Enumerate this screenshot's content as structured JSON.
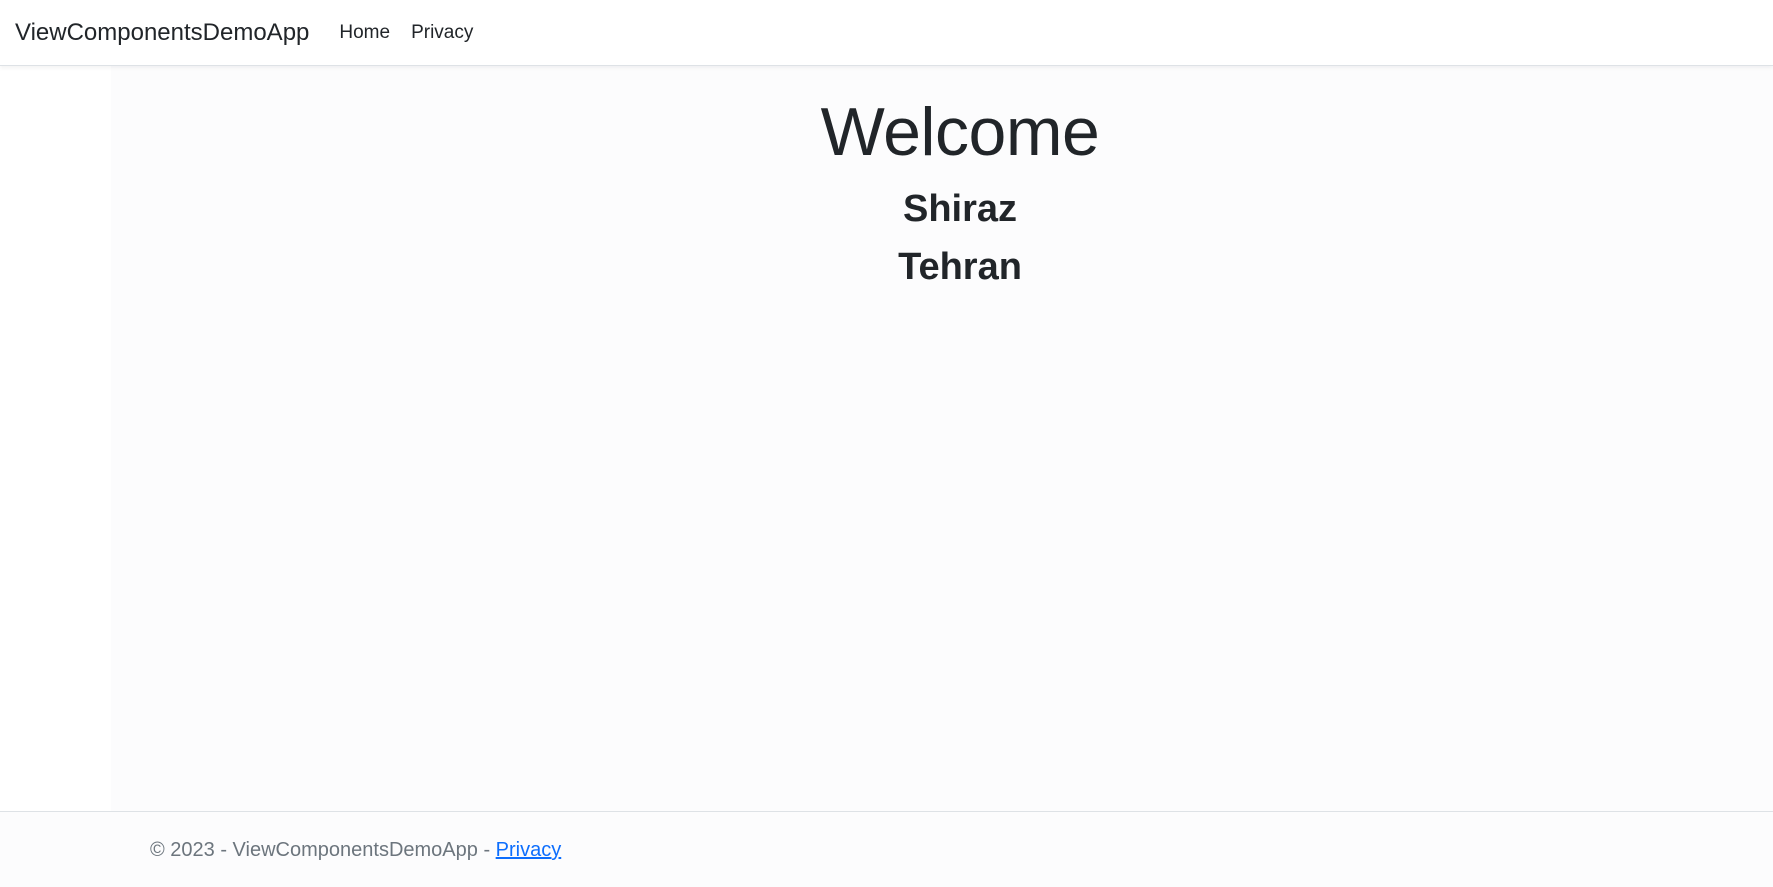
{
  "navbar": {
    "brand": "ViewComponentsDemoApp",
    "links": [
      {
        "label": "Home"
      },
      {
        "label": "Privacy"
      }
    ]
  },
  "main": {
    "heading": "Welcome",
    "cities": [
      "Shiraz",
      "Tehran"
    ]
  },
  "footer": {
    "copyright": "© 2023 - ViewComponentsDemoApp - ",
    "privacy_link": "Privacy"
  },
  "colors": {
    "link": "#0d6efd",
    "text": "#212529",
    "muted": "#6c757d",
    "border": "#dee2e6"
  }
}
